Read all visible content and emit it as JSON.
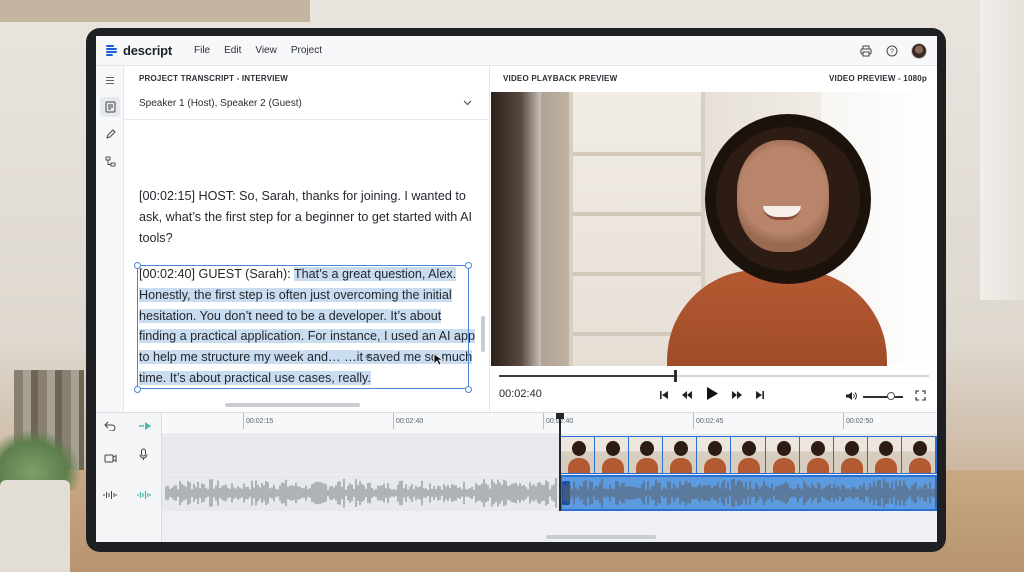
{
  "app": {
    "name": "descript",
    "menu": [
      "File",
      "Edit",
      "View",
      "Project"
    ],
    "icons_right": [
      "printer-icon",
      "help-icon",
      "user-avatar"
    ]
  },
  "rail": {
    "icons": [
      "menu-icon",
      "transcript-icon",
      "pencil-icon",
      "scenes-icon"
    ]
  },
  "transcript": {
    "title": "PROJECT TRANSCRIPT - INTERVIEW",
    "speakers": "Speaker 1 (Host), Speaker 2 (Guest)",
    "para1": "[00:02:15] HOST: So, Sarah, thanks for joining. I wanted to ask, what’s the first step for a beginner to get started with AI tools?",
    "para2_prefix": "[00:02:40] GUEST (Sarah): ",
    "para2_selected": "That’s a great question, Alex. Honestly, the first step is often just overcoming the initial hesitation. You don’t need to be a developer. It’s about finding a practical application. For instance, I used an AI app to help me structure my week and… …it saved me so much time. It’s about practical use cases, really."
  },
  "preview": {
    "title": "VIDEO PLAYBACK PREVIEW",
    "quality": "VIDEO PREVIEW - 1080p",
    "timecode": "00:02:40",
    "progress": 0.41,
    "volume": 0.7
  },
  "timeline": {
    "ticks": [
      "00:02:15",
      "00:02:40",
      "00:02:40",
      "00:02:45",
      "00:02:50"
    ],
    "frames": 11
  },
  "colors": {
    "accent": "#2a6fd1",
    "selection": "#c9dcf0"
  }
}
